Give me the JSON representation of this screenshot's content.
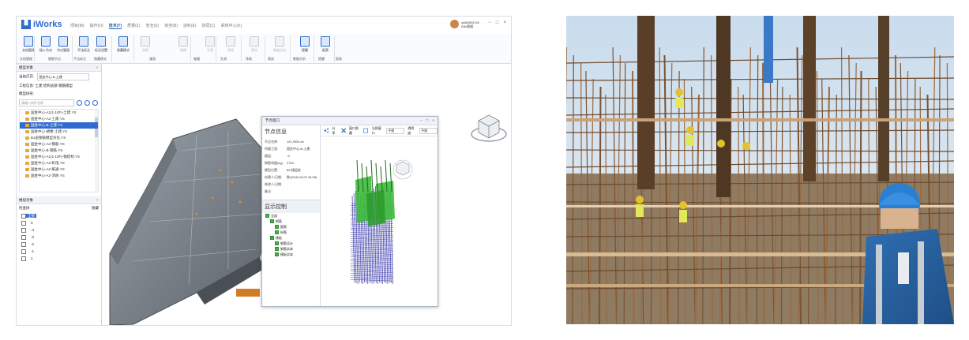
{
  "app": {
    "name": "iWorks",
    "menus": [
      "项目(M)",
      "操作(O)",
      "技术(T)",
      "质量(Z)",
      "安全(S)",
      "商务(B)",
      "进料(E)",
      "协同(C)",
      "系统中心(X)"
    ],
    "active_menu": "技术(T)",
    "user": {
      "account": "sjh88833194",
      "role": "BIM建模"
    },
    "window_controls": [
      "−",
      "□",
      "×"
    ]
  },
  "ribbon": {
    "buttons": [
      {
        "label": "文档管理",
        "enabled": true
      },
      {
        "label": "插入节点",
        "enabled": true
      },
      {
        "label": "节点管理",
        "enabled": true
      },
      {
        "label": "平法标注",
        "enabled": true
      },
      {
        "label": "标注设置",
        "enabled": true
      },
      {
        "label": "隐藏模式",
        "enabled": true
      },
      {
        "label": "测量",
        "enabled": false
      },
      {
        "label": "碰撞",
        "enabled": false
      },
      {
        "label": "孔洞",
        "enabled": false
      },
      {
        "label": "净高",
        "enabled": false
      },
      {
        "label": "筛选",
        "enabled": false
      },
      {
        "label": "数据分析",
        "enabled": false
      },
      {
        "label": "提醒",
        "enabled": true
      },
      {
        "label": "报表",
        "enabled": true
      }
    ],
    "groups": [
      "文档管理",
      "钢筋节点",
      "平法标注",
      "隐藏模式",
      "漫游",
      "碰撞",
      "孔洞",
      "净高",
      "筛选",
      "数据分析",
      "提醒",
      "报表"
    ]
  },
  "left_panel": {
    "title": "模型对象",
    "current_project_label": "当前打开:",
    "current_project_value": "国金中心-B-土建",
    "project_info": "工程信息: 土建 结构总部 钢筋模型",
    "model_label": "模型树形:",
    "search_placeholder": "请输入构件名称",
    "tree_items": [
      "国金中心-A1(1-10F)-土建.YS",
      "国金中心-A2-土建.YS",
      "国金中心-B-土建.YS",
      "国金中心-裙楼-土建.YS",
      "B1层钢筋模型深化.YS",
      "国金中心-A2-钢筋.YS",
      "国金中心-B-钢筋.YS",
      "国金中心-A1(1-10F)-钢结构.YS",
      "国金中心-A2-机电.YS",
      "国金中心-A2-暖通.YS",
      "国金中心-A2-消防.YS"
    ],
    "selected_index": 2
  },
  "layer_panel": {
    "title": "楼层对象",
    "filter_label": "检查树",
    "filter_right": "隐藏",
    "root": "全部",
    "floors": [
      "0",
      "-4",
      "-3",
      "-2",
      "-1",
      "1"
    ]
  },
  "dialog": {
    "title": "节点窗口",
    "controls": [
      "−",
      "□",
      "×"
    ],
    "section_info": "节点信息",
    "info": [
      {
        "k": "节点名称:",
        "v": "JX1-RB3-4e"
      },
      {
        "k": "所属工程:",
        "v": "国金中心-B-土建"
      },
      {
        "k": "楼层:",
        "v": "-3"
      },
      {
        "k": "钢筋吨量(kg):",
        "v": "2764"
      },
      {
        "k": "模型位置:",
        "v": "B3 楼层柱"
      },
      {
        "k": "创建人/日期:",
        "v": "陈(2018-03-02 16:05)"
      },
      {
        "k": "修改人/日期:",
        "v": ""
      },
      {
        "k": "备注:",
        "v": ""
      }
    ],
    "section_display": "显示控制",
    "display_tree": [
      "全部",
      "钢筋",
      "箍筋",
      "纵筋",
      "模板",
      "钢筋设计",
      "钢筋实体",
      "模板实体"
    ],
    "toolbar": {
      "btn1": "分享",
      "btn2": "窗口隐藏",
      "btn3": "当前窗口",
      "select1": "不限",
      "label": "透明度",
      "select2": "不限"
    }
  },
  "colors": {
    "accent": "#2f6bd1",
    "rebar_green": "#3dbb3a",
    "rebar_blue": "#3b3ba8"
  },
  "photo": {
    "subject": "construction-site-rebar-cage-photo"
  }
}
